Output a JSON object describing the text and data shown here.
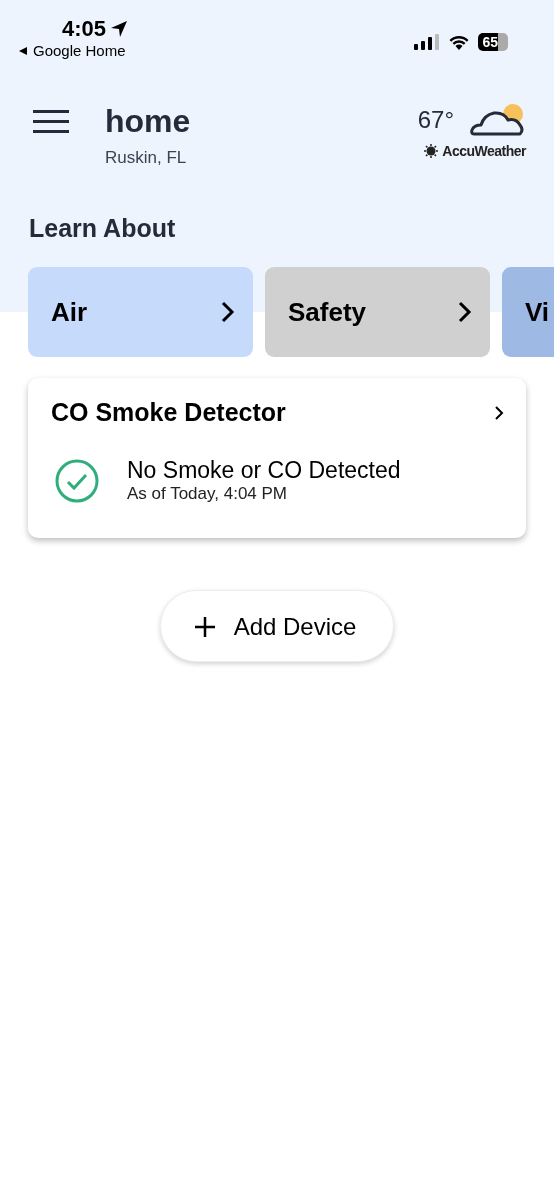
{
  "status_bar": {
    "time": "4:05",
    "back_label": "Google Home",
    "battery": "65"
  },
  "header": {
    "title": "home",
    "location": "Ruskin, FL",
    "temperature": "67°",
    "weather_source": "AccuWeather"
  },
  "learn_about": {
    "heading": "Learn About",
    "topics": [
      {
        "label": "Air",
        "color": "#c6dafc"
      },
      {
        "label": "Safety",
        "color": "#d0d0d0"
      },
      {
        "label": "Vi",
        "color": "#9db9e4"
      }
    ]
  },
  "device_card": {
    "name": "CO Smoke Detector",
    "status": "No Smoke or CO Detected",
    "updated": "As of Today, 4:04 PM"
  },
  "add_button": {
    "label": "Add Device"
  }
}
